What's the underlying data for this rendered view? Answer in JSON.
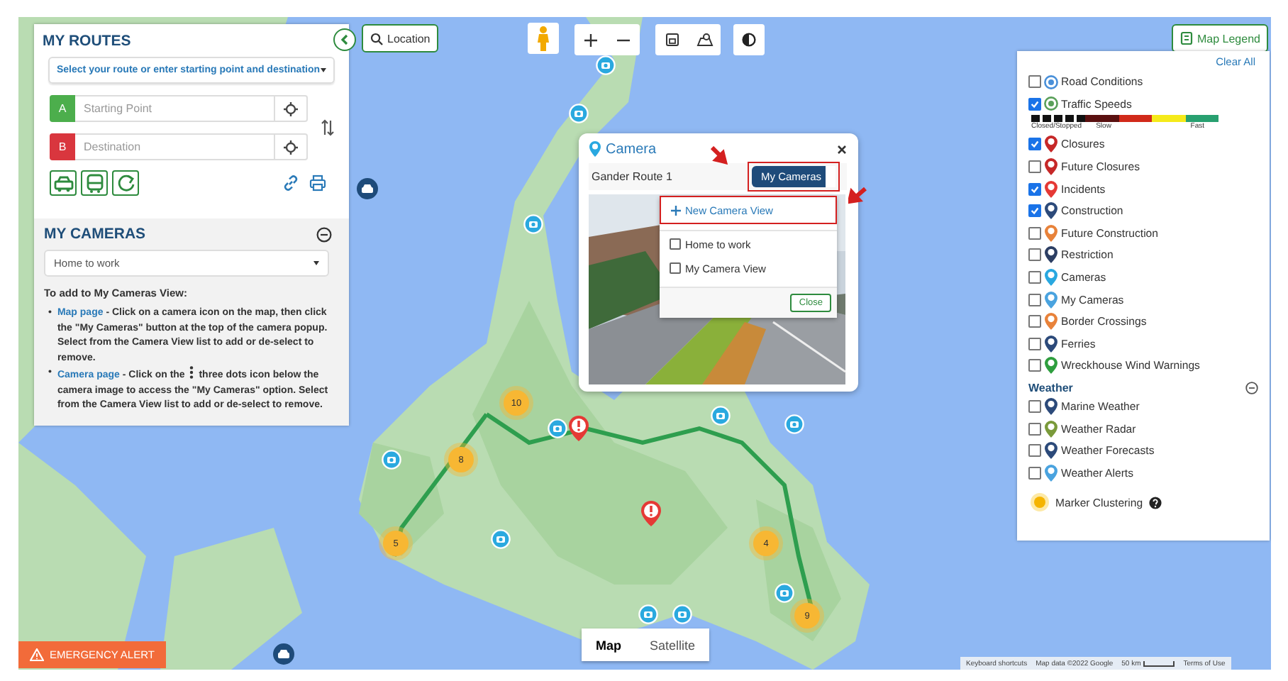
{
  "routes_panel": {
    "title": "MY ROUTES",
    "route_select": "Select your route or enter starting point and destination",
    "stops": [
      {
        "badge": "A",
        "color": "#4cae4c",
        "placeholder": "Starting Point"
      },
      {
        "badge": "B",
        "color": "#d9363e",
        "placeholder": "Destination"
      }
    ]
  },
  "cameras_panel": {
    "title": "MY CAMERAS",
    "expanded": true,
    "view_select": "Home to work",
    "intro": "To add to My Cameras View:",
    "tips": [
      {
        "bullet": "•",
        "link": "Map page",
        "text": " - Click on a camera icon on the map, then click the \"My Cameras\" button at the top of the camera popup. Select from the Camera View list to add or de-select to remove."
      },
      {
        "bullet": "•",
        "link": "Camera page",
        "text": " - Click on the ",
        "after": " three dots icon below the camera image to access the \"My Cameras\" option. Select from the Camera View list to add or de-select to remove."
      }
    ]
  },
  "toolbar": {
    "location": "Location",
    "legend_button": "Map Legend"
  },
  "camera_popup": {
    "title": "Camera",
    "camera_name": "Gander Route 1",
    "menu_button": {
      "label": "My Cameras",
      "highlighted": true
    },
    "new_view": {
      "label": "New Camera View",
      "highlighted": true
    },
    "views": [
      {
        "label": "Home to work",
        "checked": false
      },
      {
        "label": "My Camera View",
        "checked": false
      }
    ],
    "close": "Close"
  },
  "legend": {
    "clear": "Clear All",
    "layers": [
      {
        "label": "Road Conditions",
        "checked": false,
        "kind": "dot",
        "color": "#4a90d9"
      },
      {
        "label": "Traffic Speeds",
        "checked": true,
        "kind": "dot",
        "color": "#5aa05a"
      },
      {
        "label": "Closures",
        "checked": true,
        "kind": "pin",
        "color": "#c62828"
      },
      {
        "label": "Future Closures",
        "checked": false,
        "kind": "pin",
        "color": "#c62828"
      },
      {
        "label": "Incidents",
        "checked": true,
        "kind": "pin",
        "color": "#e53935"
      },
      {
        "label": "Construction",
        "checked": true,
        "kind": "pin",
        "color": "#2c4a7a"
      },
      {
        "label": "Future Construction",
        "checked": false,
        "kind": "pin",
        "color": "#e8823a"
      },
      {
        "label": "Restriction",
        "checked": false,
        "kind": "pin",
        "color": "#2c3e63"
      },
      {
        "label": "Cameras",
        "checked": false,
        "kind": "pin",
        "color": "#29a8e0"
      },
      {
        "label": "My Cameras",
        "checked": false,
        "kind": "pin",
        "color": "#4aa3df"
      },
      {
        "label": "Border Crossings",
        "checked": false,
        "kind": "pin",
        "color": "#e8823a"
      },
      {
        "label": "Ferries",
        "checked": false,
        "kind": "pin",
        "color": "#2c4a7a"
      },
      {
        "label": "Wreckhouse Wind Warnings",
        "checked": false,
        "kind": "pin",
        "color": "#2e9e3e"
      }
    ],
    "speed_labels": [
      "Closed/Stopped",
      "Slow",
      "Fast"
    ],
    "weather": {
      "title": "Weather",
      "expanded": true,
      "layers": [
        {
          "label": "Marine Weather",
          "checked": false,
          "color": "#2c4a7a"
        },
        {
          "label": "Weather Radar",
          "checked": false,
          "color": "#7a9a3a"
        },
        {
          "label": "Weather Forecasts",
          "checked": false,
          "color": "#2c4a7a"
        },
        {
          "label": "Weather Alerts",
          "checked": false,
          "color": "#4aa3df"
        }
      ]
    },
    "clustering": "Marker Clustering"
  },
  "clusters": [
    "10",
    "8",
    "5",
    "4",
    "9"
  ],
  "map_type": [
    {
      "label": "Map",
      "selected": true
    },
    {
      "label": "Satellite",
      "selected": false
    }
  ],
  "emergency_alert": "EMERGENCY ALERT",
  "attribution": [
    "Keyboard shortcuts",
    "Map data ©2022 Google",
    "50 km",
    "Terms of Use"
  ]
}
